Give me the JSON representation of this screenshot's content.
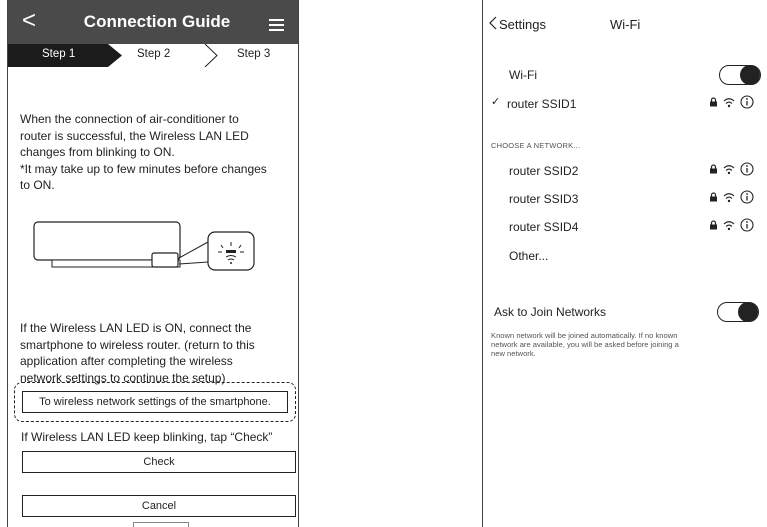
{
  "left_screen": {
    "header": {
      "back": "<",
      "title": "Connection Guide"
    },
    "steps": {
      "step1": "Step 1",
      "step2": "Step 2",
      "step3": "Step 3"
    },
    "paragraph1_lines": [
      "When the connection of air-conditioner to",
      "router is successful, the Wireless LAN LED",
      "changes from blinking to  ON.",
      "*It may take up to few minutes before changes",
      "to ON."
    ],
    "paragraph2_lines": [
      "If the Wireless LAN LED is ON, connect the",
      "smartphone to wireless router. (return to this",
      "application after completing the wireless",
      "network settings to continue the setup)"
    ],
    "wifi_settings_button": "To wireless network settings of the smartphone.",
    "blinking_note": "If Wireless LAN LED keep blinking, tap “Check”",
    "check_button": "Check",
    "cancel_button": "Cancel"
  },
  "right_screen": {
    "back": "Settings",
    "title": "Wi-Fi",
    "wifi_label": "Wi-Fi",
    "connected_network": "router SSID1",
    "section_header": "CHOOSE A NETWORK...",
    "networks": [
      "router SSID2",
      "router SSID3",
      "router SSID4"
    ],
    "other": "Other...",
    "ask_join_label": "Ask to Join Networks",
    "known_lines": [
      "Known network will be joined automatically. If no known",
      "network are available, you will be asked before joining a",
      "new network."
    ]
  },
  "colors": {
    "header_bg": "#4a4a4a",
    "step_active_bg": "#1b1b1b"
  },
  "toggles": {
    "wifi_on": true,
    "ask_to_join_on": true
  },
  "icons": [
    "back-icon",
    "menu-icon",
    "lock-icon",
    "wifi-signal-icon",
    "info-icon",
    "checkmark-icon"
  ]
}
